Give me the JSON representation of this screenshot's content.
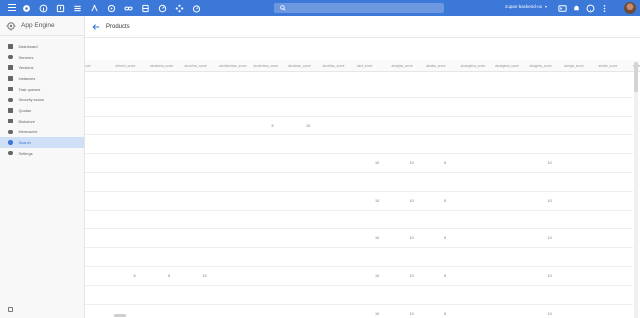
{
  "topbar": {
    "icons": [
      "apps-icon",
      "info-icon",
      "alert-icon",
      "dashboard-icon",
      "routing-icon",
      "rocket-icon",
      "link-icon",
      "database-icon",
      "gauge-icon",
      "flow-icon",
      "timer-icon"
    ],
    "search_placeholder": "",
    "project_name": "zupan-backend-ox",
    "right_icons": [
      "terminal-icon",
      "notifications-icon",
      "help-icon",
      "more-icon"
    ]
  },
  "sidebar": {
    "title": "App Engine",
    "items": [
      {
        "label": "Dashboard",
        "icon": "dashboard-icon",
        "active": false
      },
      {
        "label": "Services",
        "icon": "services-icon",
        "active": false
      },
      {
        "label": "Versions",
        "icon": "versions-icon",
        "active": false
      },
      {
        "label": "Instances",
        "icon": "instances-icon",
        "active": false
      },
      {
        "label": "Task queues",
        "icon": "task-queues-icon",
        "active": false
      },
      {
        "label": "Security scans",
        "icon": "security-scans-icon",
        "active": false
      },
      {
        "label": "Quotas",
        "icon": "quotas-icon",
        "active": false
      },
      {
        "label": "Blobstore",
        "icon": "blobstore-icon",
        "active": false
      },
      {
        "label": "Memcache",
        "icon": "memcache-icon",
        "active": false
      },
      {
        "label": "Search",
        "icon": "search-icon",
        "active": true
      },
      {
        "label": "Settings",
        "icon": "settings-icon",
        "active": false
      }
    ]
  },
  "page": {
    "title": "Products"
  },
  "table": {
    "columns": [
      "_score",
      "aliment_score",
      "alcaesma_score",
      "alcoolmo_score",
      "alcoflacmtao_score",
      "alcobeissa_score",
      "alcobissu_score",
      "alcobiisu_score",
      "alcd_score",
      "alcegisa_score",
      "alcalas_score",
      "alcaegiima_score",
      "alcaegima_score",
      "alcagimu_score",
      "alcegia_score",
      "alcede_score",
      "alcrfa_score"
    ],
    "rows": [
      [],
      [],
      [
        {
          "col": 5,
          "value": "5"
        },
        {
          "col": 6,
          "value": "10"
        }
      ],
      [],
      [
        {
          "col": 8,
          "value": "10"
        },
        {
          "col": 9,
          "value": "10"
        },
        {
          "col": 10,
          "value": "5"
        },
        {
          "col": 13,
          "value": "10"
        }
      ],
      [],
      [
        {
          "col": 8,
          "value": "10"
        },
        {
          "col": 9,
          "value": "10"
        },
        {
          "col": 10,
          "value": "5"
        },
        {
          "col": 13,
          "value": "10"
        }
      ],
      [],
      [
        {
          "col": 8,
          "value": "10"
        },
        {
          "col": 9,
          "value": "10"
        },
        {
          "col": 10,
          "value": "5"
        },
        {
          "col": 13,
          "value": "10"
        }
      ],
      [],
      [
        {
          "col": 1,
          "value": "5"
        },
        {
          "col": 2,
          "value": "5"
        },
        {
          "col": 3,
          "value": "10"
        },
        {
          "col": 8,
          "value": "10"
        },
        {
          "col": 9,
          "value": "10"
        },
        {
          "col": 10,
          "value": "5"
        },
        {
          "col": 13,
          "value": "10"
        }
      ],
      [],
      [
        {
          "col": 8,
          "value": "10"
        },
        {
          "col": 9,
          "value": "10"
        },
        {
          "col": 10,
          "value": "5"
        },
        {
          "col": 13,
          "value": "10"
        }
      ]
    ]
  }
}
